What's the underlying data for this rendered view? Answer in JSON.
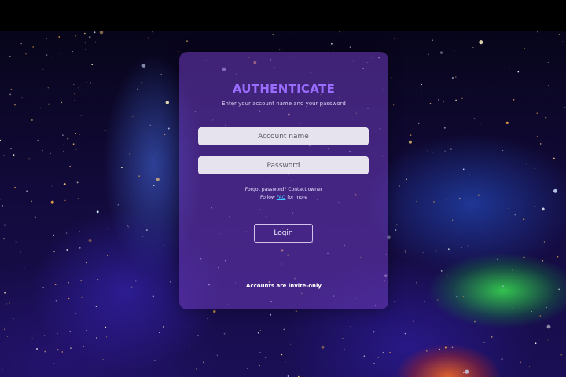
{
  "auth": {
    "title": "AUTHENTICATE",
    "subtitle": "Enter your account name and your password",
    "account_placeholder": "Account name",
    "password_placeholder": "Password",
    "help_line1": "Forgot password? Contact owner",
    "help_follow": "Follow",
    "help_faq": "FAQ",
    "help_more": "for more",
    "login_label": "Login",
    "footer": "Accounts are invite-only"
  },
  "colors": {
    "title": "#9a6cff",
    "link": "#3ec8ff",
    "panel": "#6e3cbe"
  }
}
